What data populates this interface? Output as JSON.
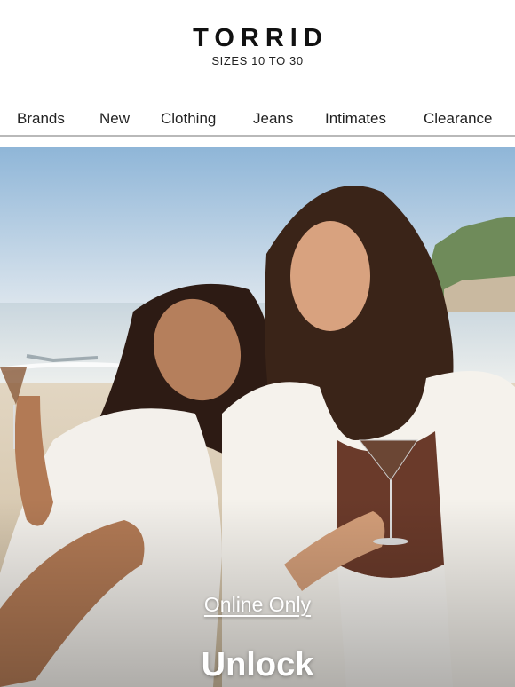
{
  "brand": {
    "logo": "TORRID",
    "tagline": "SIZES 10 TO 30"
  },
  "nav": {
    "items": [
      "Brands",
      "New",
      "Clothing",
      "Jeans",
      "Intimates",
      "Clearance"
    ]
  },
  "hero": {
    "image_alt": "Two women laughing on a beach holding cocktails",
    "kicker": "Online Only",
    "title": "Unlock"
  },
  "colors": {
    "sky": "#9fc3e0",
    "sea": "#dfe6ea",
    "sand": "#d9cbb5",
    "text": "#111111"
  }
}
